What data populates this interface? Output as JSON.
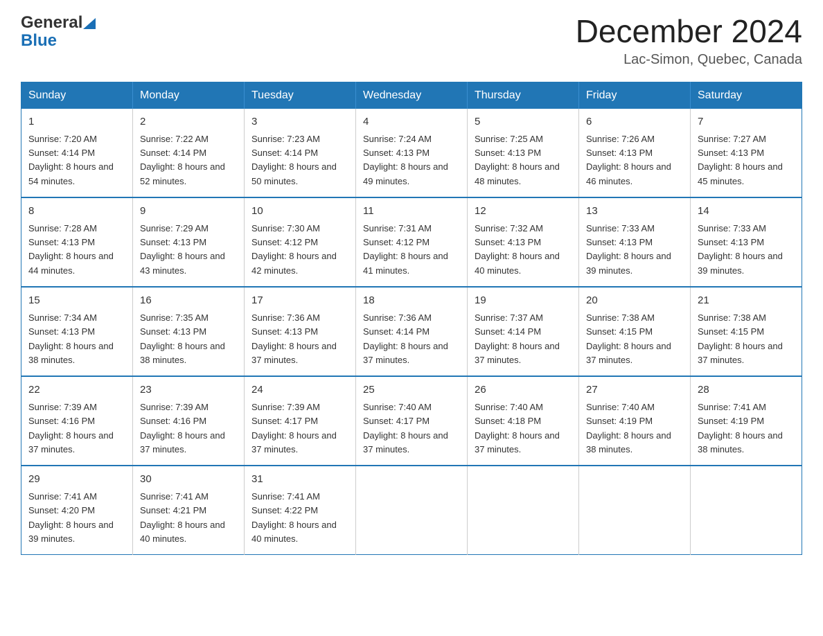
{
  "header": {
    "logo_general": "General",
    "logo_blue": "Blue",
    "title": "December 2024",
    "location": "Lac-Simon, Quebec, Canada"
  },
  "days_of_week": [
    "Sunday",
    "Monday",
    "Tuesday",
    "Wednesday",
    "Thursday",
    "Friday",
    "Saturday"
  ],
  "weeks": [
    [
      {
        "day": 1,
        "sunrise": "7:20 AM",
        "sunset": "4:14 PM",
        "daylight": "8 hours and 54 minutes."
      },
      {
        "day": 2,
        "sunrise": "7:22 AM",
        "sunset": "4:14 PM",
        "daylight": "8 hours and 52 minutes."
      },
      {
        "day": 3,
        "sunrise": "7:23 AM",
        "sunset": "4:14 PM",
        "daylight": "8 hours and 50 minutes."
      },
      {
        "day": 4,
        "sunrise": "7:24 AM",
        "sunset": "4:13 PM",
        "daylight": "8 hours and 49 minutes."
      },
      {
        "day": 5,
        "sunrise": "7:25 AM",
        "sunset": "4:13 PM",
        "daylight": "8 hours and 48 minutes."
      },
      {
        "day": 6,
        "sunrise": "7:26 AM",
        "sunset": "4:13 PM",
        "daylight": "8 hours and 46 minutes."
      },
      {
        "day": 7,
        "sunrise": "7:27 AM",
        "sunset": "4:13 PM",
        "daylight": "8 hours and 45 minutes."
      }
    ],
    [
      {
        "day": 8,
        "sunrise": "7:28 AM",
        "sunset": "4:13 PM",
        "daylight": "8 hours and 44 minutes."
      },
      {
        "day": 9,
        "sunrise": "7:29 AM",
        "sunset": "4:13 PM",
        "daylight": "8 hours and 43 minutes."
      },
      {
        "day": 10,
        "sunrise": "7:30 AM",
        "sunset": "4:12 PM",
        "daylight": "8 hours and 42 minutes."
      },
      {
        "day": 11,
        "sunrise": "7:31 AM",
        "sunset": "4:12 PM",
        "daylight": "8 hours and 41 minutes."
      },
      {
        "day": 12,
        "sunrise": "7:32 AM",
        "sunset": "4:13 PM",
        "daylight": "8 hours and 40 minutes."
      },
      {
        "day": 13,
        "sunrise": "7:33 AM",
        "sunset": "4:13 PM",
        "daylight": "8 hours and 39 minutes."
      },
      {
        "day": 14,
        "sunrise": "7:33 AM",
        "sunset": "4:13 PM",
        "daylight": "8 hours and 39 minutes."
      }
    ],
    [
      {
        "day": 15,
        "sunrise": "7:34 AM",
        "sunset": "4:13 PM",
        "daylight": "8 hours and 38 minutes."
      },
      {
        "day": 16,
        "sunrise": "7:35 AM",
        "sunset": "4:13 PM",
        "daylight": "8 hours and 38 minutes."
      },
      {
        "day": 17,
        "sunrise": "7:36 AM",
        "sunset": "4:13 PM",
        "daylight": "8 hours and 37 minutes."
      },
      {
        "day": 18,
        "sunrise": "7:36 AM",
        "sunset": "4:14 PM",
        "daylight": "8 hours and 37 minutes."
      },
      {
        "day": 19,
        "sunrise": "7:37 AM",
        "sunset": "4:14 PM",
        "daylight": "8 hours and 37 minutes."
      },
      {
        "day": 20,
        "sunrise": "7:38 AM",
        "sunset": "4:15 PM",
        "daylight": "8 hours and 37 minutes."
      },
      {
        "day": 21,
        "sunrise": "7:38 AM",
        "sunset": "4:15 PM",
        "daylight": "8 hours and 37 minutes."
      }
    ],
    [
      {
        "day": 22,
        "sunrise": "7:39 AM",
        "sunset": "4:16 PM",
        "daylight": "8 hours and 37 minutes."
      },
      {
        "day": 23,
        "sunrise": "7:39 AM",
        "sunset": "4:16 PM",
        "daylight": "8 hours and 37 minutes."
      },
      {
        "day": 24,
        "sunrise": "7:39 AM",
        "sunset": "4:17 PM",
        "daylight": "8 hours and 37 minutes."
      },
      {
        "day": 25,
        "sunrise": "7:40 AM",
        "sunset": "4:17 PM",
        "daylight": "8 hours and 37 minutes."
      },
      {
        "day": 26,
        "sunrise": "7:40 AM",
        "sunset": "4:18 PM",
        "daylight": "8 hours and 37 minutes."
      },
      {
        "day": 27,
        "sunrise": "7:40 AM",
        "sunset": "4:19 PM",
        "daylight": "8 hours and 38 minutes."
      },
      {
        "day": 28,
        "sunrise": "7:41 AM",
        "sunset": "4:19 PM",
        "daylight": "8 hours and 38 minutes."
      }
    ],
    [
      {
        "day": 29,
        "sunrise": "7:41 AM",
        "sunset": "4:20 PM",
        "daylight": "8 hours and 39 minutes."
      },
      {
        "day": 30,
        "sunrise": "7:41 AM",
        "sunset": "4:21 PM",
        "daylight": "8 hours and 40 minutes."
      },
      {
        "day": 31,
        "sunrise": "7:41 AM",
        "sunset": "4:22 PM",
        "daylight": "8 hours and 40 minutes."
      },
      null,
      null,
      null,
      null
    ]
  ]
}
